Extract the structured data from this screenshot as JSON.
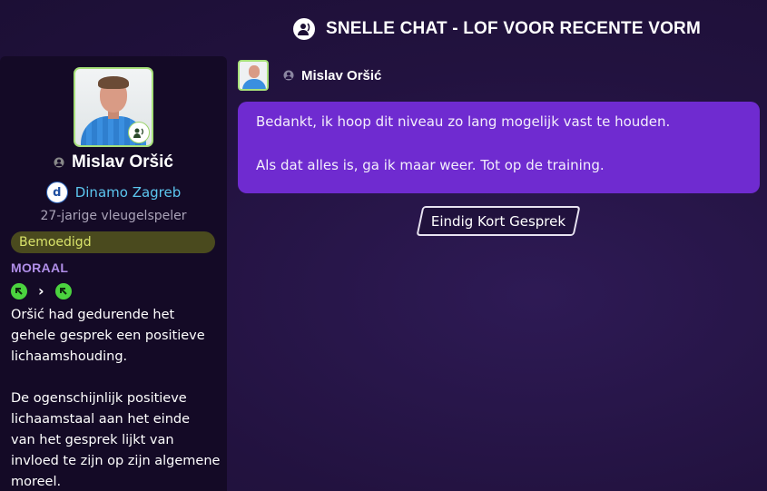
{
  "header": {
    "title": "SNELLE CHAT - LOF VOOR RECENTE VORM",
    "icon": "chat-person-icon"
  },
  "player": {
    "name": "Mislav Oršić",
    "club": "Dinamo Zagreb",
    "club_logo_letter": "d",
    "role": "27-jarige vleugelspeler",
    "mood": "Bemoedigd",
    "morale_label": "MORAAL",
    "morale_icons": [
      "morale-up-icon",
      "chevron-right-icon",
      "morale-up-icon"
    ],
    "description": "Oršić had gedurende het\ngehele gesprek een positieve\nlichaamshouding.\n\nDe ogenschijnlijk positieve\nlichaamstaal aan het einde\nvan het gesprek lijkt van\ninvloed te zijn op zijn algemene\nmoreel."
  },
  "chat": {
    "speaker": "Mislav Oršić",
    "lines": [
      "Bedankt, ik hoop dit niveau zo lang mogelijk vast te houden.",
      "Als dat alles is, ga ik maar weer. Tot op de training."
    ],
    "end_button": "Eindig Kort Gesprek"
  },
  "colors": {
    "accent": "#6f2bd0",
    "positive": "#4bd33f",
    "club": "#5cc6ef",
    "mood_bg": "#4a4a1e"
  }
}
